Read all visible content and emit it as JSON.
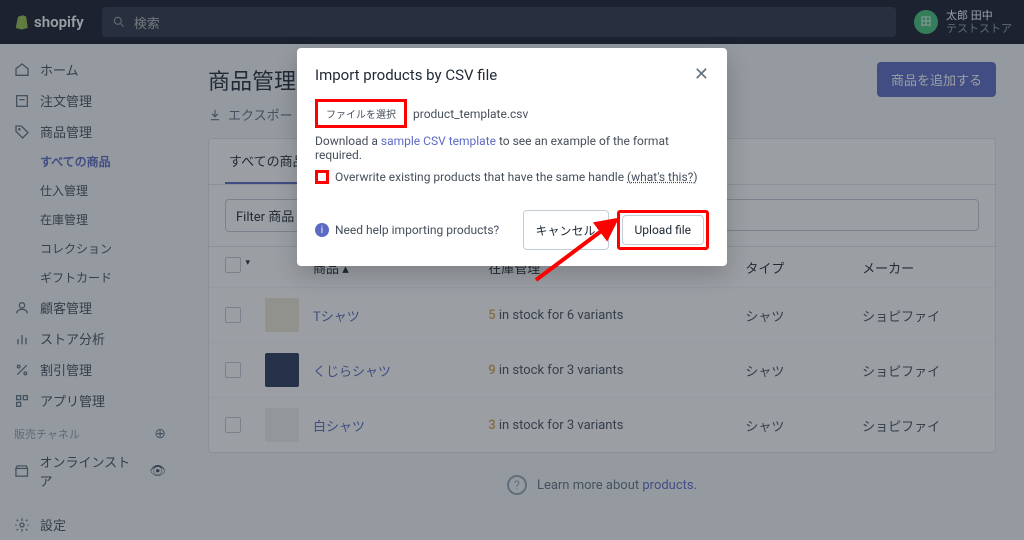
{
  "brand": "shopify",
  "search_placeholder": "検索",
  "user": {
    "initials": "田",
    "name": "太郎 田中",
    "store": "テストストア"
  },
  "nav": {
    "home": "ホーム",
    "orders": "注文管理",
    "products": "商品管理",
    "products_all": "すべての商品",
    "purchases": "仕入管理",
    "inventory": "在庫管理",
    "collections": "コレクション",
    "giftcards": "ギフトカード",
    "customers": "顧客管理",
    "analytics": "ストア分析",
    "discounts": "割引管理",
    "apps": "アプリ管理",
    "sales_channels": "販売チャネル",
    "online_store": "オンラインストア",
    "settings": "設定"
  },
  "page": {
    "title": "商品管理",
    "add_button": "商品を追加する",
    "export": "エクスポート",
    "tab_all": "すべての商品",
    "filter_label": "Filter 商品",
    "learn_more_prefix": "Learn more about ",
    "learn_more_link": "products"
  },
  "table": {
    "cols": {
      "product": "商品",
      "inventory": "在庫管理",
      "type": "タイプ",
      "vendor": "メーカー"
    },
    "rows": [
      {
        "name": "Tシャツ",
        "stock_n": "5",
        "stock_t": " in stock for 6 variants",
        "type": "シャツ",
        "vendor": "ショピファイ"
      },
      {
        "name": "くじらシャツ",
        "stock_n": "9",
        "stock_t": " in stock for 3 variants",
        "type": "シャツ",
        "vendor": "ショピファイ"
      },
      {
        "name": "白シャツ",
        "stock_n": "3",
        "stock_t": " in stock for 3 variants",
        "type": "シャツ",
        "vendor": "ショピファイ"
      }
    ]
  },
  "modal": {
    "title": "Import products by CSV file",
    "file_button": "ファイルを選択",
    "file_name": "product_template.csv",
    "download_prefix": "Download a ",
    "download_link": "sample CSV template",
    "download_suffix": " to see an example of the format required.",
    "overwrite": "Overwrite existing products that have the same handle ",
    "whats_this": "(what's this?)",
    "help": "Need help importing products?",
    "cancel": "キャンセル",
    "upload": "Upload file"
  }
}
